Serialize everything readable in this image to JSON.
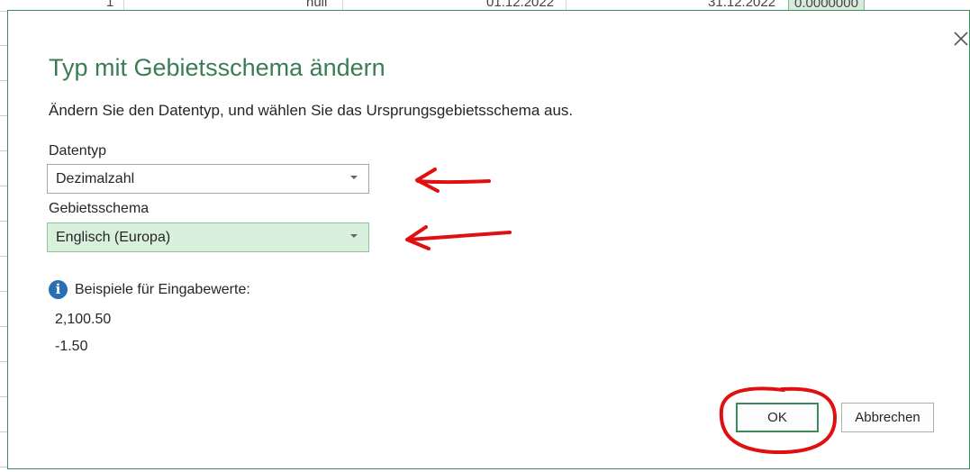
{
  "background": {
    "cells": [
      "1",
      "null",
      "01.12.2022",
      "31.12.2022",
      "0.0000000"
    ]
  },
  "dialog": {
    "title": "Typ mit Gebietsschema ändern",
    "subtitle": "Ändern Sie den Datentyp, und wählen Sie das Ursprungsgebietsschema aus.",
    "datatype": {
      "label": "Datentyp",
      "value": "Dezimalzahl"
    },
    "locale": {
      "label": "Gebietsschema",
      "value": "Englisch (Europa)"
    },
    "examples": {
      "heading": "Beispiele für Eingabewerte:",
      "values": [
        "2,100.50",
        "-1.50"
      ]
    },
    "buttons": {
      "ok": "OK",
      "cancel": "Abbrechen"
    }
  },
  "colors": {
    "title": "#3a7d55",
    "accent_border": "#3a8c5a",
    "locale_highlight": "#d9f0dc",
    "info_icon": "#2a6fb3",
    "annotation_red": "#e01010"
  },
  "icons": {
    "close": "close-icon",
    "info": "info-icon",
    "dropdown": "chevron-down-icon"
  }
}
